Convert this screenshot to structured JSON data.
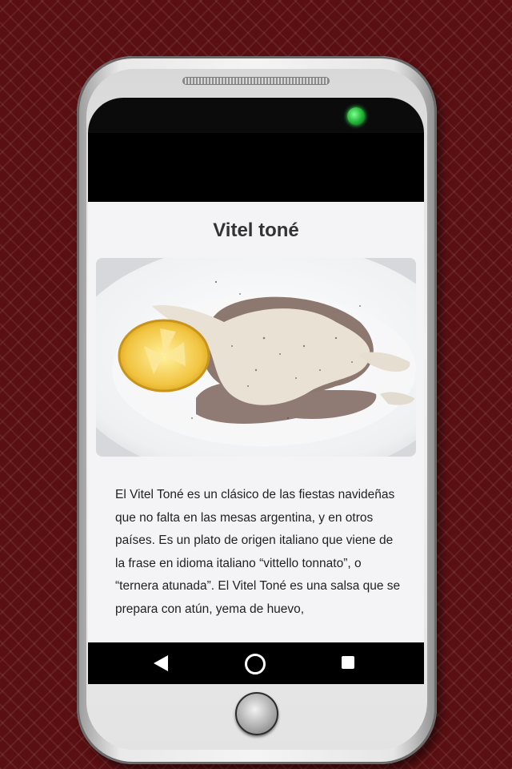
{
  "app": {
    "title": "Vitel toné",
    "description": "El Vitel Toné es un clásico de las fiestas navideñas que no falta en las mesas argentina, y en otros países. Es un plato de origen italiano que viene de la frase en idioma italiano “vittello tonnato”, o “ternera atunada”. El Vitel Toné es una salsa que se prepara con atún, yema de huevo,"
  },
  "nav": {
    "back_icon": "back-triangle-icon",
    "home_icon": "home-circle-icon",
    "recent_icon": "recent-square-icon"
  },
  "colors": {
    "background": "#5a0f12",
    "status_bar": "#000000",
    "content_bg": "#f4f4f6",
    "led": "#20b236"
  }
}
